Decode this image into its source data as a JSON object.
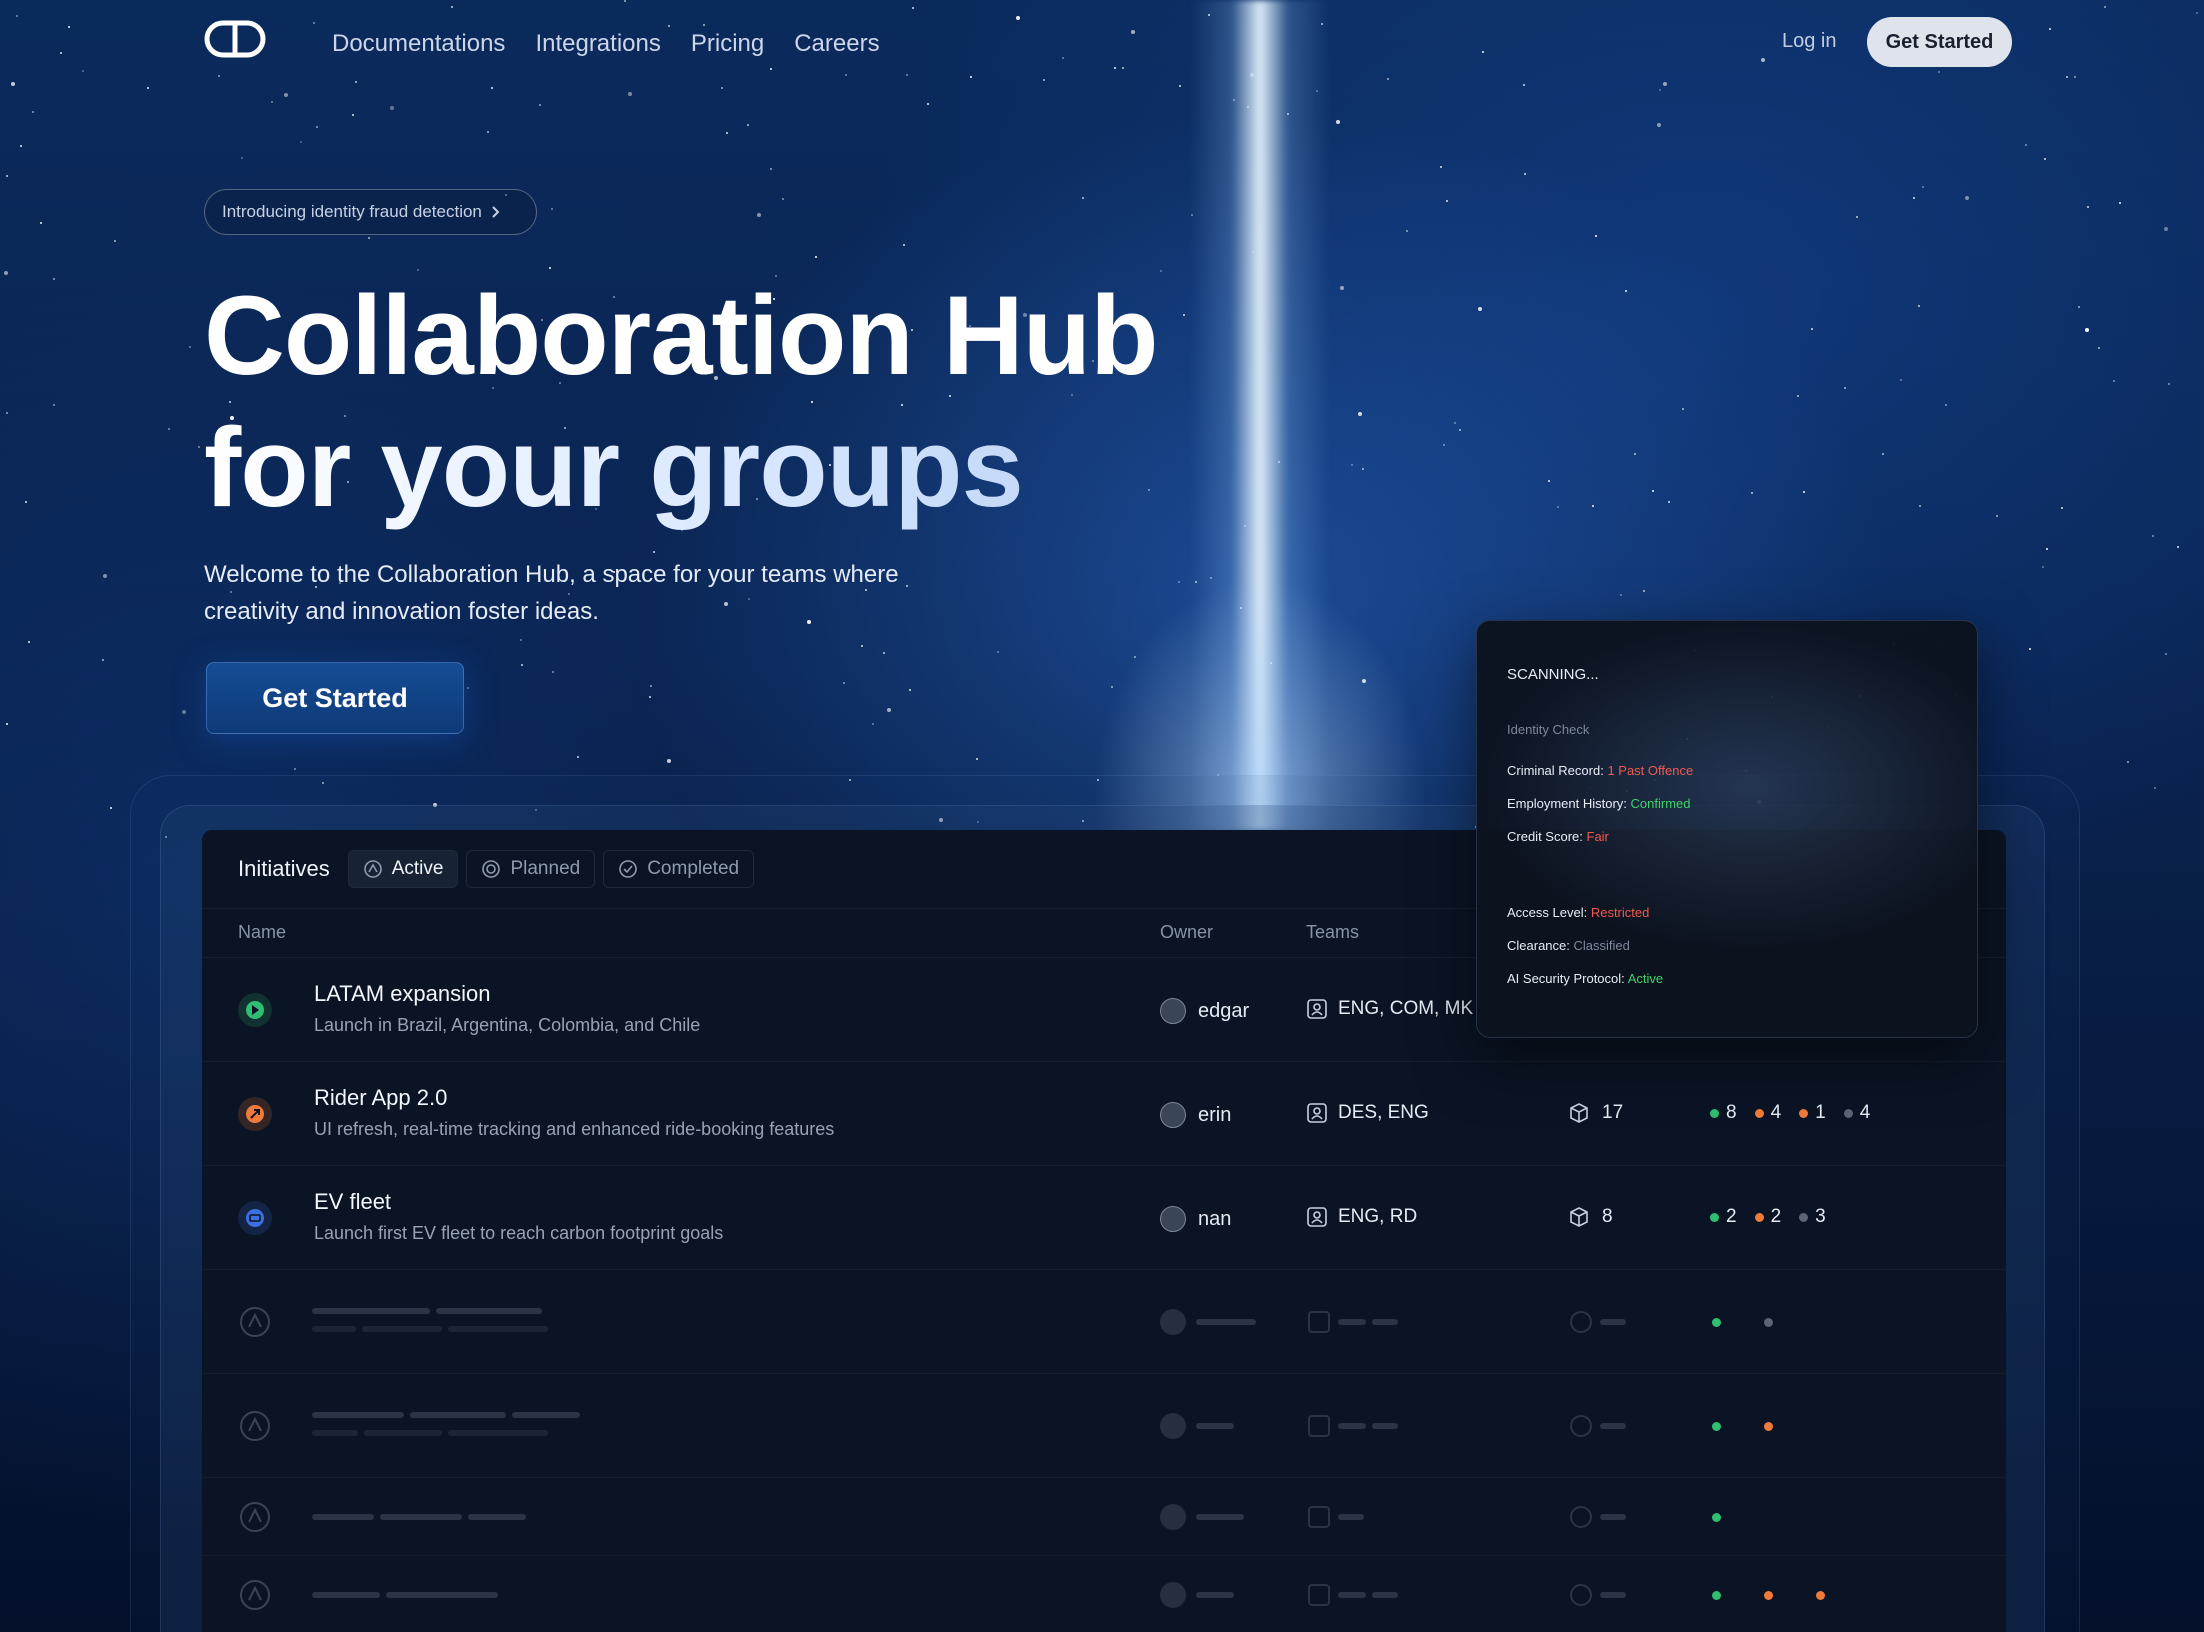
{
  "nav": {
    "links": [
      "Documentations",
      "Integrations",
      "Pricing",
      "Careers"
    ],
    "login": "Log in",
    "cta": "Get Started"
  },
  "hero": {
    "announcement": "Introducing identity fraud detection",
    "title_line1": "Collaboration Hub",
    "title_line2": "for your groups",
    "subtitle": "Welcome to the Collaboration Hub, a space for your teams where creativity and innovation foster ideas.",
    "cta": "Get Started"
  },
  "panel": {
    "title": "Initiatives",
    "tabs": [
      "Active",
      "Planned",
      "Completed"
    ],
    "columns": {
      "name": "Name",
      "owner": "Owner",
      "teams": "Teams"
    },
    "rows": [
      {
        "name": "LATAM expansion",
        "desc": "Launch in Brazil, Argentina, Colombia, and Chile",
        "owner": "edgar",
        "teams": "ENG, COM, MK",
        "status_color": "#2fbf71"
      },
      {
        "name": "Rider App 2.0",
        "desc": "UI refresh, real-time tracking and enhanced ride-booking features",
        "owner": "erin",
        "teams": "DES, ENG",
        "count": "17",
        "stats": [
          "8",
          "4",
          "1",
          "4"
        ],
        "status_color": "#f07a3a"
      },
      {
        "name": "EV fleet",
        "desc": "Launch first EV fleet to reach carbon footprint goals",
        "owner": "nan",
        "teams": "ENG, RD",
        "count": "8",
        "stats": [
          "2",
          "2",
          "3"
        ],
        "status_color": "#3c6fe0"
      }
    ]
  },
  "scan": {
    "title": "SCANNING...",
    "subtitle": "Identity Check",
    "criminal_label": "Criminal Record:",
    "criminal_value": "1 Past Offence",
    "employment_label": "Employment History:",
    "employment_value": "Confirmed",
    "credit_label": "Credit Score:",
    "credit_value": "Fair",
    "access_label": "Access Level:",
    "access_value": "Restricted",
    "clearance_label": "Clearance:",
    "clearance_value": "Classified",
    "ai_label": "AI Security Protocol:",
    "ai_value": "Active"
  },
  "colors": {
    "accent_green": "#3fd26a",
    "accent_orange": "#f07a3a",
    "accent_red": "#f05a4f",
    "accent_gray": "#8793a8"
  }
}
